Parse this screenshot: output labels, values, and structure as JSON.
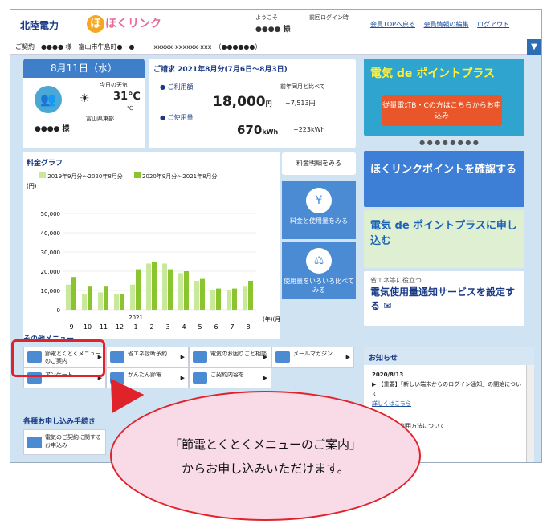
{
  "header": {
    "brand": "北陸電力",
    "service": "ほくリンク",
    "welcome": "ようこそ",
    "user": "●●●● 様",
    "last_login": "前回ログイン時",
    "links": [
      "会員TOPへ戻る",
      "会員情報の編集",
      "ログアウト"
    ]
  },
  "contract": {
    "label": "ご契約",
    "value": "●●●● 様　富山市牛島町●－●　　　xxxxx-xxxxxx-xxx　（●●●●●●）"
  },
  "today": {
    "date": "8月11日（水）",
    "weather_label": "今日の天気",
    "temp": "31℃",
    "temp2": "－℃",
    "region": "富山県東部",
    "user": "●●●● 様"
  },
  "bill": {
    "title": "ご請求 2021年8月分(7月6日～8月3日)",
    "amount_label": "ご利用額",
    "amount": "18,000",
    "amount_unit": "円",
    "usage_label": "ご使用量",
    "usage": "670",
    "usage_unit": "kWh",
    "compare_label": "前年同月と比べて",
    "compare_amount": "+7,513円",
    "compare_usage": "+223kWh"
  },
  "graph": {
    "title": "料金グラフ",
    "legend": [
      "2019年9月分～2020年8月分",
      "2020年9月分～2021年8月分"
    ],
    "yunit": "(円)",
    "xunit": "(年)(月)",
    "yticks": [
      "50,000",
      "40,000",
      "30,000",
      "20,000",
      "10,000",
      "0"
    ],
    "xticks": [
      "9",
      "10",
      "11",
      "12",
      "1",
      "2",
      "3",
      "4",
      "5",
      "6",
      "7",
      "8"
    ],
    "year": "2021"
  },
  "chart_data": {
    "type": "bar",
    "categories": [
      "9",
      "10",
      "11",
      "12",
      "1",
      "2",
      "3",
      "4",
      "5",
      "6",
      "7",
      "8"
    ],
    "series": [
      {
        "name": "2019年9月分～2020年8月分",
        "values": [
          13000,
          8000,
          9000,
          8000,
          13000,
          24000,
          24000,
          19000,
          15000,
          10000,
          10000,
          12000
        ]
      },
      {
        "name": "2020年9月分～2021年8月分",
        "values": [
          17000,
          12000,
          12000,
          8000,
          21000,
          25000,
          21000,
          20000,
          16000,
          11000,
          11000,
          15000
        ]
      }
    ],
    "ylim": [
      0,
      50000
    ],
    "ylabel": "(円)"
  },
  "side": {
    "detail": "料金明細をみる",
    "fee_usage": "料金と使用量をみる",
    "compare": "使用量をいろいろ比べてみる"
  },
  "banners": {
    "b1_title": "電気 de ポイントプラス",
    "b1_sub": "従量電灯B・Cの方はこちらからお申込み",
    "b2": "ほくリンクポイントを確認する",
    "b3": "電気 de ポイントプラスに申し込む",
    "b4_sub": "省エネ等に役立つ",
    "b4": "電気使用量通知サービスを設定する"
  },
  "notice": {
    "title": "お知らせ",
    "date": "2020/8/13",
    "item1": "【重要】「新しい端末からのログイン通知」の開始について",
    "more": "詳しくはこちら",
    "item2": "アプリのご利用方法について"
  },
  "other": {
    "title": "その他メニュー",
    "items": [
      "節電とくとくメニューのご案内",
      "省エネ診断予約",
      "電気のお困りごと相談",
      "メールマガジン",
      "アンケート",
      "かんたん節電",
      "ご契約内容を"
    ]
  },
  "apply": {
    "title": "各種お申し込み手続き",
    "item": "電気のご契約に関するお申込み"
  },
  "callout": {
    "line1": "「節電とくとくメニューのご案内」",
    "line2": "からお申し込みいただけます。"
  }
}
